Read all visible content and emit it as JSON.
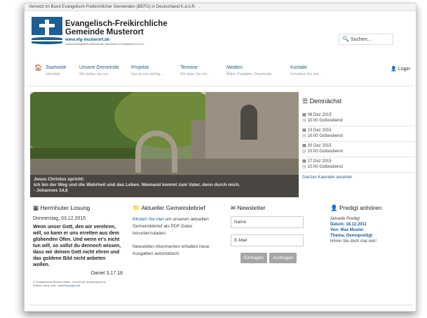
{
  "topbar": {
    "text": "Vernetzt im Bund Evangelisch-Freikirchlicher Gemeinden (BEFG) in Deutschland K.d.ö.R.",
    "chevron": "⌄"
  },
  "brand": {
    "line1": "Evangelisch-Freikirchliche",
    "line2": "Gemeinde Musterort",
    "url": "www.efg-musterort.de",
    "sub": "im Bund Evangelisch-Freikirchlicher Gemeinden in Deutschland K.d.ö.R."
  },
  "search": {
    "placeholder": "Suchen...",
    "icon": "search-icon"
  },
  "nav": {
    "items": [
      {
        "label": "Startseite",
        "sub": "Überblick"
      },
      {
        "label": "Unsere Gemeinde",
        "sub": "Wir stellen uns vor..."
      },
      {
        "label": "Projekte",
        "sub": "Das ist uns wichtig..."
      },
      {
        "label": "Termine",
        "sub": "Wir laden Sie ein..."
      },
      {
        "label": "Medien",
        "sub": "Bilder, Predigten, Downloads"
      },
      {
        "label": "Kontakt",
        "sub": "Schreiben Sie uns..."
      }
    ],
    "login": "Login"
  },
  "hero": {
    "caption_title": "Jesus Christus spricht:",
    "caption_text": "Ich bin der Weg und die Wahrheit und das Leben. Niemand kommt zum Vater, denn durch mich.",
    "caption_ref": "- Johannes 14,6"
  },
  "upcoming": {
    "title": "Demnächst",
    "events": [
      {
        "date": "06 Dez 2015",
        "time": "10:00",
        "name": "Gottesdienst"
      },
      {
        "date": "13 Dez 2015",
        "time": "10:00",
        "name": "Gottesdienst"
      },
      {
        "date": "20 Dez 2015",
        "time": "10:00",
        "name": "Gottesdienst"
      },
      {
        "date": "27 Dez 2015",
        "time": "10:00",
        "name": "Gottesdienst"
      }
    ],
    "calendar_link": "Ganzen Kalender ansehen"
  },
  "losung": {
    "title": "Herrnhuter Losung",
    "date": "Donnerstag, 03.12.2015",
    "text": "Wenn unser Gott, den wir verehren, will, so kann er uns erretten aus dem glühenden Ofen. Und wenn er's nicht tun will, so sollst du dennoch wissen, dass wir deinen Gott nicht ehren und das goldene Bild nicht anbeten wollen.",
    "ref": "Daniel 3,17.18",
    "foot1": "© Evangelische Brüder-Unität - Herrnhuter Brüdergemeine",
    "foot2_prefix": "Weitere Infos unter:",
    "foot2_link": "www.losungen.de"
  },
  "gemeindebrief": {
    "title": "Aktueller Gemeindebrief",
    "link": "Klicken Sie hier",
    "text1": "um unseren aktuellen Gemeindebrief als PDF-Datei herunterzuladen.",
    "text2": "Newsletter-Abonnenten erhalten neue Ausgaben automatisch."
  },
  "newsletter": {
    "title": "Newsletter",
    "name_placeholder": "Name",
    "email_placeholder": "E-Mail",
    "subscribe": "Eintragen",
    "unsubscribe": "Austragen"
  },
  "predigt": {
    "title": "Predigt anhören",
    "label": "Aktuelle Predigt",
    "date": "Datum: 18.12.2011",
    "by": "Von: Max Muster",
    "theme": "Thema: Demopredigt",
    "cta": "Hören Sie doch mal rein!"
  }
}
